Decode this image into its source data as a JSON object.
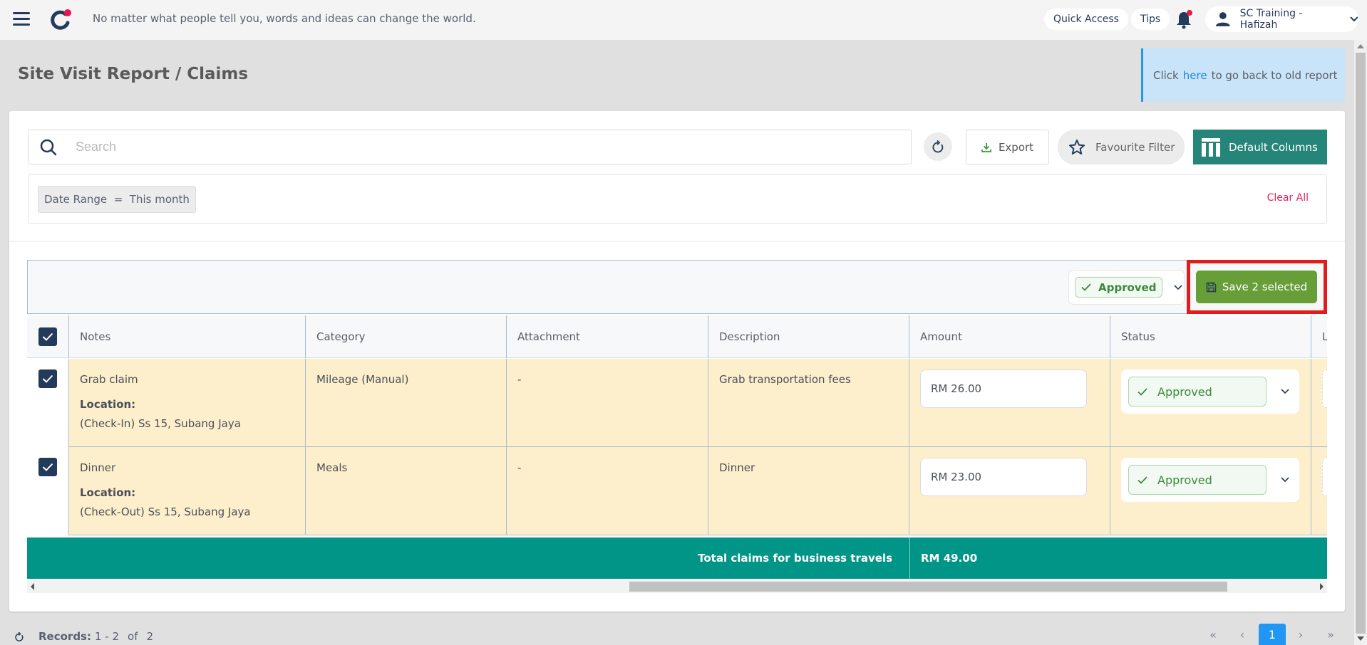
{
  "topbar": {
    "quote": "No matter what people tell you, words and ideas can change the world.",
    "quick_access": "Quick Access",
    "tips": "Tips",
    "user_name": "SC Training - Hafizah",
    "notification_dot_color": "#e8174d"
  },
  "page": {
    "title": "Site Visit Report / Claims",
    "old_report": {
      "prefix": "Click",
      "link": "here",
      "suffix": "to go back to old report"
    }
  },
  "toolbar": {
    "search_placeholder": "Search",
    "export_label": "Export",
    "favourite_filter_label": "Favourite Filter",
    "default_columns_label": "Default Columns"
  },
  "filters": {
    "chips": [
      {
        "label": "Date Range  =  This month"
      }
    ],
    "clear_all": "Clear All"
  },
  "bulk": {
    "status_value": "Approved",
    "save_label": "Save 2 selected"
  },
  "table": {
    "columns": [
      "Notes",
      "Category",
      "Attachment",
      "Description",
      "Amount",
      "Status",
      "L"
    ],
    "rows": [
      {
        "checked": true,
        "notes": "Grab claim",
        "location_label": "Location:",
        "location": "(Check-In) Ss 15, Subang Jaya",
        "category": "Mileage (Manual)",
        "attachment": "-",
        "description": "Grab transportation fees",
        "amount": "RM 26.00",
        "status": "Approved"
      },
      {
        "checked": true,
        "notes": "Dinner",
        "location_label": "Location:",
        "location": "(Check-Out) Ss 15, Subang Jaya",
        "category": "Meals",
        "attachment": "-",
        "description": "Dinner",
        "amount": "RM 23.00",
        "status": "Approved"
      }
    ],
    "total_label": "Total claims for business travels",
    "total_value": "RM 49.00"
  },
  "footer": {
    "records_label": "Records:",
    "records_range": "1 - 2",
    "records_of": "of",
    "records_total": "2",
    "pagination": {
      "first": "«",
      "prev": "‹",
      "current": "1",
      "next": "›",
      "last": "»"
    }
  },
  "colors": {
    "brand_navy": "#243a5a",
    "teal": "#268579",
    "total_teal": "#009586",
    "save_green": "#679e38",
    "highlight_red": "#e21b1b",
    "row_highlight": "#fdefcc",
    "link_blue": "#1e88e5",
    "clear_all_pink": "#e0245e"
  }
}
